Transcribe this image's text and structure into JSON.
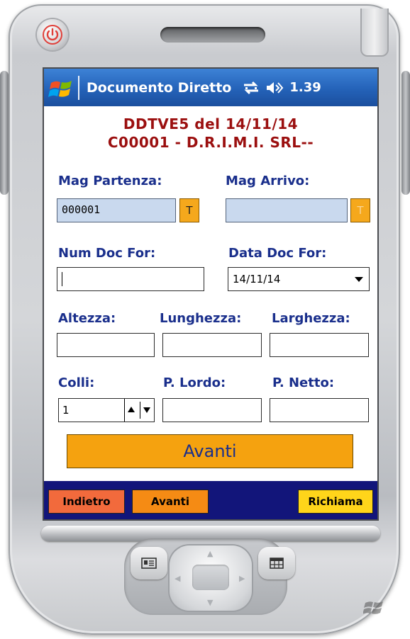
{
  "window": {
    "title": "Documento Diretto",
    "clock": "1.39",
    "icons": [
      "windows-start-icon",
      "connectivity-icon",
      "speaker-icon"
    ]
  },
  "header": {
    "line1": "DDTVE5 del 14/11/14",
    "line2": "C00001 - D.R.I.M.I. SRL--"
  },
  "form": {
    "mag_partenza": {
      "label": "Mag Partenza:",
      "value": "000001",
      "button": "T"
    },
    "mag_arrivo": {
      "label": "Mag Arrivo:",
      "value": "",
      "button": "T"
    },
    "num_doc_for": {
      "label": "Num Doc For:",
      "value": ""
    },
    "data_doc_for": {
      "label": "Data Doc For:",
      "value": "14/11/14"
    },
    "altezza": {
      "label": "Altezza:",
      "value": ""
    },
    "lunghezza": {
      "label": "Lunghezza:",
      "value": ""
    },
    "larghezza": {
      "label": "Larghezza:",
      "value": ""
    },
    "colli": {
      "label": "Colli:",
      "value": "1"
    },
    "p_lordo": {
      "label": "P. Lordo:",
      "value": ""
    },
    "p_netto": {
      "label": "P. Netto:",
      "value": ""
    },
    "avanti_label": "Avanti"
  },
  "bottombar": {
    "indietro": "Indietro",
    "avanti": "Avanti",
    "richiama": "Richiama"
  },
  "colors": {
    "title_bg": "#2462b8",
    "header_text": "#9b0f0f",
    "label_text": "#1a2f8c",
    "orange": "#f5a20f",
    "bottom_bar": "#12157a",
    "indietro_bg": "#f26a3c",
    "avanti_small_bg": "#f58b14",
    "richiama_bg": "#ffd51a"
  }
}
